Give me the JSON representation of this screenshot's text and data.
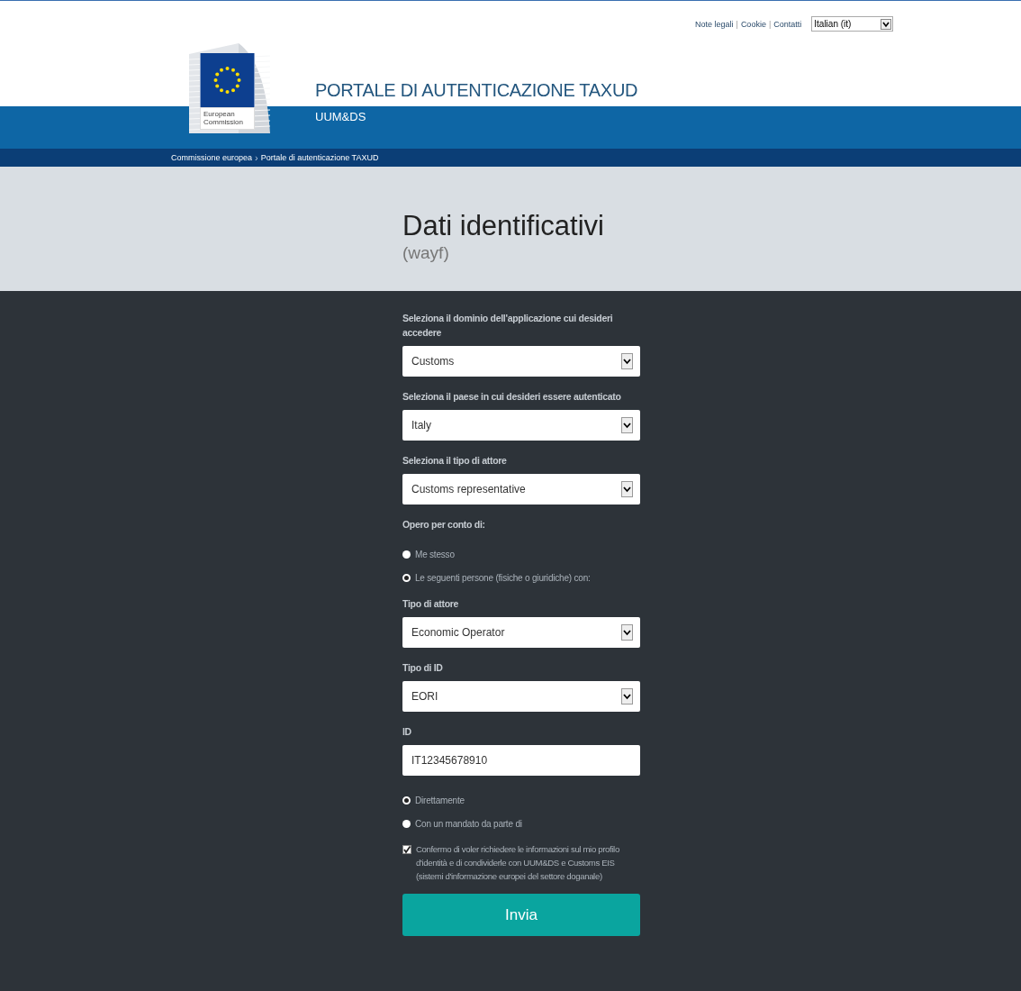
{
  "top_links": [
    {
      "kind": "link",
      "label": "Note legali"
    },
    {
      "kind": "separator",
      "label": "|"
    },
    {
      "kind": "link",
      "label": "Cookie"
    },
    {
      "kind": "separator",
      "label": "|"
    },
    {
      "kind": "link",
      "label": "Contatti"
    }
  ],
  "language_select": {
    "value": "Italian (it)"
  },
  "logo": {
    "caption": "European Commission"
  },
  "site_title": "PORTALE DI AUTENTICAZIONE TAXUD",
  "site_subtitle": "UUM&DS",
  "breadcrumb": [
    {
      "kind": "link",
      "label": "Commissione europea"
    },
    {
      "kind": "separator",
      "label": "›"
    },
    {
      "kind": "link",
      "label": "Portale di autenticazione TAXUD"
    }
  ],
  "page_title": "Dati identificativi",
  "page_subtitle": "(wayf)",
  "form": {
    "items": [
      {
        "kind": "select",
        "label": "Seleziona il dominio dell'applicazione cui desideri accedere",
        "value": "Customs"
      },
      {
        "kind": "select",
        "label": "Seleziona il paese in cui desideri essere autenticato",
        "value": "Italy"
      },
      {
        "kind": "select",
        "label": "Seleziona il tipo di attore",
        "value": "Customs representative"
      },
      {
        "kind": "radios",
        "label": "Opero per conto di:",
        "options": [
          {
            "label": "Me stesso",
            "selected": false
          },
          {
            "label": "Le seguenti persone (fisiche o giuridiche) con:",
            "selected": true
          }
        ]
      },
      {
        "kind": "select",
        "label": "Tipo di attore",
        "value": "Economic Operator"
      },
      {
        "kind": "select",
        "label": "Tipo di ID",
        "value": "EORI"
      },
      {
        "kind": "input",
        "label": "ID",
        "value": "IT12345678910"
      },
      {
        "kind": "radios",
        "options": [
          {
            "label": "Direttamente",
            "selected": true
          },
          {
            "label": "Con un mandato da parte di",
            "selected": false
          }
        ]
      },
      {
        "kind": "checkbox",
        "label": "Confermo di voler richiedere le informazioni sul mio profilo d'identità e di condividerle con UUM&DS e Customs EIS (sistemi d'informazione europei del settore doganale)",
        "checked": true
      }
    ],
    "submit_label": "Invia"
  }
}
